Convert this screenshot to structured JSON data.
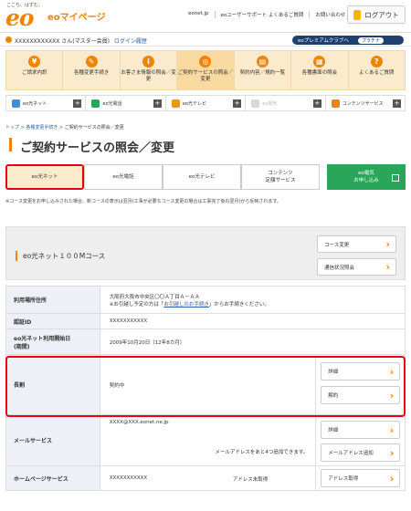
{
  "header": {
    "tagline": "ここち、はずむ。",
    "logo": "eo",
    "brand": "eoマイページ",
    "links": [
      "eonet.jp",
      "eoユーザーサポート よくあるご質問",
      "お問い合わせ"
    ],
    "logout": "ログアウト"
  },
  "userbar": {
    "user": "XXXXXXXXXXXX さん(マスター会員)",
    "login_history": "ログイン履歴",
    "premium": "eoプレミアムクラブへ",
    "rank": "プラチナ"
  },
  "nav": [
    {
      "icon": "¥",
      "label": "ご請求内訳"
    },
    {
      "icon": "✎",
      "label": "各種変更手続き"
    },
    {
      "icon": "i",
      "label": "お客さま情報の照会／変更"
    },
    {
      "icon": "◎",
      "label": "ご契約サービスの照会／変更"
    },
    {
      "icon": "▤",
      "label": "契約内容／規約一覧"
    },
    {
      "icon": "▦",
      "label": "各種書面の照会"
    },
    {
      "icon": "?",
      "label": "よくあるご質問"
    }
  ],
  "services": [
    {
      "label": "eo光ネット",
      "color": "#3a8fd6"
    },
    {
      "label": "eo光電話",
      "color": "#2aa65a"
    },
    {
      "label": "eo光テレビ",
      "color": "#e89a0c"
    },
    {
      "label": "eo電気",
      "color": "#d8d8d8"
    },
    {
      "label": "コンテンツサービス",
      "color": "#f08300"
    }
  ],
  "breadcrumb": {
    "top": "トップ",
    "sep": " > ",
    "mid": "各種変更手続き",
    "current": "ご契約サービスの照会／変更"
  },
  "title": "ご契約サービスの照会／変更",
  "subtabs": {
    "net": "eo光ネット",
    "phone": "eo光電話",
    "tv": "eo光テレビ",
    "contents_line1": "コンテンツ",
    "contents_line2": "定額サービス",
    "denki_line1": "eo電気",
    "denki_line2": "お申し込み"
  },
  "note": "※コース変更をお申し込みされた場合、新コースの表示は翌月(工事が必要なコース変更の場合は工事完了後の翌月)から反映されます。",
  "course": {
    "name": "eo光ネット１００Mコース",
    "btn_change": "コース変更",
    "btn_status": "通信状況照会"
  },
  "table": {
    "address_label": "利用場所住所",
    "address_value": "大阪府大阪市中央区〇〇Ａ丁目Ａ－ＡＡ",
    "moving_note_pre": "※お引越し予定の方は「",
    "moving_link": "お引越しのお手続き",
    "moving_note_post": "」からお手続きください。",
    "id_label": "認証ID",
    "id_value": "XXXXXXXXXXX",
    "start_label_1": "eo光ネット利用開始日",
    "start_label_2": "(期間)",
    "start_value": "2009年10月20日（12年8カ月）",
    "choki_label": "長割",
    "choki_value": "契約中",
    "btn_detail": "詳細",
    "btn_cancel": "解約",
    "mail_label": "メールサービス",
    "mail_value": "XXXX@XXX.eonet.ne.jp",
    "mail_more": "メールアドレスをあと4つ追加できます。",
    "btn_mail_add": "メールアドレス追加",
    "hp_label": "ホームページサービス",
    "hp_value": "XXXXXXXXXXX",
    "hp_status": "アドレス未取得",
    "btn_address": "アドレス取得"
  }
}
